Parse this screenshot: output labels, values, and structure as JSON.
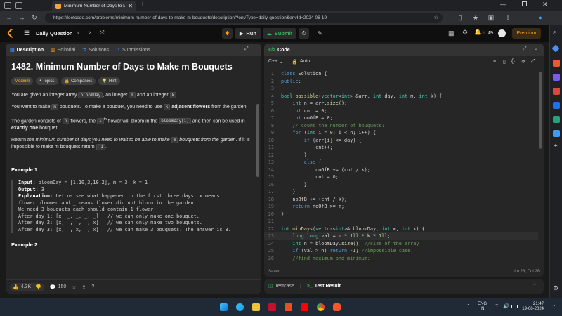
{
  "browser": {
    "tab_title": "Minimum Number of Days to M",
    "url": "https://leetcode.com/problems/minimum-number-of-days-to-make-m-bouquets/description/?envType=daily-question&envId=2024-06-19"
  },
  "lc_top": {
    "daily_question": "Daily Question",
    "run": "Run",
    "submit": "Submit",
    "streak": "49",
    "premium": "Premium"
  },
  "left": {
    "tabs": [
      "Description",
      "Editorial",
      "Solutions",
      "Submissions"
    ],
    "title": "1482. Minimum Number of Days to Make m Bouquets",
    "tags": [
      "Medium",
      "Topics",
      "Companies",
      "Hint"
    ],
    "p1_a": "You are given an integer array ",
    "p1_code1": "bloomDay",
    "p1_b": ", an integer ",
    "p1_code2": "m",
    "p1_c": " and an integer ",
    "p1_code3": "k",
    "p1_d": ".",
    "p2_a": "You want to make ",
    "p2_code1": "m",
    "p2_b": " bouquets. To make a bouquet, you need to use ",
    "p2_code2": "k",
    "p2_bold": "adjacent flowers",
    "p2_c": " from the garden.",
    "p3_a": "The garden consists of ",
    "p3_code1": "n",
    "p3_b": " flowers, the ",
    "p3_sup": "i",
    "p3_sup2": "th",
    "p3_c": " flower will bloom in the ",
    "p3_code2": "bloomDay[i]",
    "p3_d": " and then can be used in ",
    "p3_bold": "exactly one",
    "p3_e": " bouquet.",
    "p4_a": "Return ",
    "p4_italic": "the minimum number of days you need to wait to be able to make ",
    "p4_code1": "m",
    "p4_italic2": " bouquets from the garden",
    "p4_b": ". If it is impossible to make m bouquets return ",
    "p4_code2": "-1",
    "p4_c": ".",
    "ex1_title": "Example 1:",
    "ex1_input_label": "Input:",
    "ex1_input": " bloomDay = [1,10,3,10,2], m = 3, k = 1",
    "ex1_output_label": "Output:",
    "ex1_output": " 3",
    "ex1_expl_label": "Explanation:",
    "ex1_expl1": " Let us see what happened in the first three days. x means",
    "ex1_expl2": "flower bloomed and _ means flower did not bloom in the garden.",
    "ex1_expl3": "We need 3 bouquets each should contain 1 flower.",
    "ex1_expl4": "After day 1: [x, _, _, _, _]   // we can only make one bouquet.",
    "ex1_expl5": "After day 2: [x, _, _, _, x]   // we can only make two bouquets.",
    "ex1_expl6": "After day 3: [x, _, x, _, x]   // we can make 3 bouquets. The answer is 3.",
    "ex2_title": "Example 2:",
    "likes": "4.3K",
    "comments": "150"
  },
  "code_panel": {
    "title": "Code",
    "lang": "C++",
    "auto": "Auto",
    "saved": "Saved",
    "cursor": "Ln 23, Col 28",
    "lines": [
      {
        "n": "1",
        "t": "class Solution {"
      },
      {
        "n": "2",
        "t": "public:"
      },
      {
        "n": "3",
        "t": ""
      },
      {
        "n": "4",
        "t": "bool possible(vector<int> &arr, int day, int m, int k) {"
      },
      {
        "n": "5",
        "t": "    int n = arr.size();"
      },
      {
        "n": "6",
        "t": "    int cnt = 0;"
      },
      {
        "n": "7",
        "t": "    int noOfB = 0;"
      },
      {
        "n": "8",
        "t": "    // count the number of bouquets:"
      },
      {
        "n": "9",
        "t": "    for (int i = 0; i < n; i++) {"
      },
      {
        "n": "10",
        "t": "        if (arr[i] <= day) {"
      },
      {
        "n": "11",
        "t": "            cnt++;"
      },
      {
        "n": "12",
        "t": "        }"
      },
      {
        "n": "13",
        "t": "        else {"
      },
      {
        "n": "14",
        "t": "            noOfB += (cnt / k);"
      },
      {
        "n": "15",
        "t": "            cnt = 0;"
      },
      {
        "n": "16",
        "t": "        }"
      },
      {
        "n": "17",
        "t": "    }"
      },
      {
        "n": "18",
        "t": "    noOfB += (cnt / k);"
      },
      {
        "n": "19",
        "t": "    return noOfB >= m;"
      },
      {
        "n": "20",
        "t": "}"
      },
      {
        "n": "21",
        "t": ""
      },
      {
        "n": "22",
        "t": "int minDays(vector<int>& bloomDay, int m, int k) {"
      },
      {
        "n": "23",
        "t": "    long long val = m * 1ll * k * 1ll;"
      },
      {
        "n": "24",
        "t": "    int n = bloomDay.size(); //size of the array"
      },
      {
        "n": "25",
        "t": "    if (val > n) return -1; //impossible case."
      },
      {
        "n": "26",
        "t": "    //find maximum and minimum:"
      }
    ]
  },
  "test_panel": {
    "testcase": "Testcase",
    "result": "Test Result"
  },
  "taskbar": {
    "lang": "ENG",
    "lang2": "IN",
    "time": "21:47",
    "date": "19-06-2024"
  },
  "colors": {
    "accent_orange": "#ffa116",
    "submit_green": "#2cbb5d",
    "medium_yellow": "#ffc01e"
  }
}
